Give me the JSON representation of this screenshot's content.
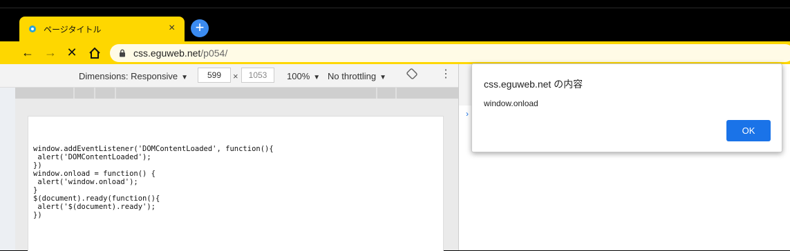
{
  "browser": {
    "tab_title": "ページタイトル",
    "tab_close": "×",
    "new_tab": "+",
    "back": "←",
    "forward": "→",
    "stop": "✕",
    "url_host": "css.eguweb.net",
    "url_path": "/p054/"
  },
  "devtools": {
    "dimensions_label": "Dimensions: Responsive",
    "width": "599",
    "height": "1053",
    "times": "×",
    "zoom": "100%",
    "throttling": "No throttling",
    "more": "⋮",
    "console_prompt": "›"
  },
  "page": {
    "code": "window.addEventListener('DOMContentLoaded', function(){\n alert('DOMContentLoaded');\n})\nwindow.onload = function() {\n alert('window.onload');\n}\n$(document).ready(function(){\n alert('$(document).ready');\n})"
  },
  "dialog": {
    "title": "css.eguweb.net の内容",
    "message": "window.onload",
    "ok_label": "OK"
  },
  "colors": {
    "theme_yellow": "#fed700",
    "accent_blue": "#1a73e8"
  }
}
